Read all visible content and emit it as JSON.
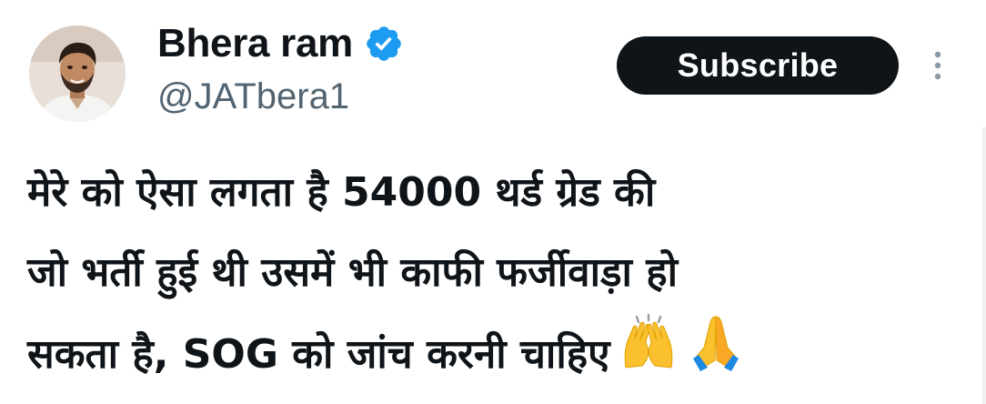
{
  "author": {
    "display_name": "Bhera ram",
    "handle": "@JATbera1",
    "verified": true,
    "avatar_icon": "profile-photo"
  },
  "actions": {
    "subscribe_label": "Subscribe",
    "more_icon": "vertical-ellipsis-icon"
  },
  "tweet": {
    "lines": [
      "मेरे को ऐसा लगता है 54000 थर्ड ग्रेड की",
      "जो भर्ती हुई थी उसमें भी काफी फर्जीवाड़ा हो",
      "सकता है, SOG को जांच करनी चाहिए"
    ],
    "emojis": [
      "raising-hands-emoji",
      "folded-hands-emoji"
    ]
  },
  "colors": {
    "text_primary": "#0f1419",
    "text_secondary": "#536471",
    "verified_blue": "#1d9bf0",
    "button_bg": "#0f1419",
    "button_text": "#ffffff",
    "emoji_yellow": "#fbc02d"
  }
}
